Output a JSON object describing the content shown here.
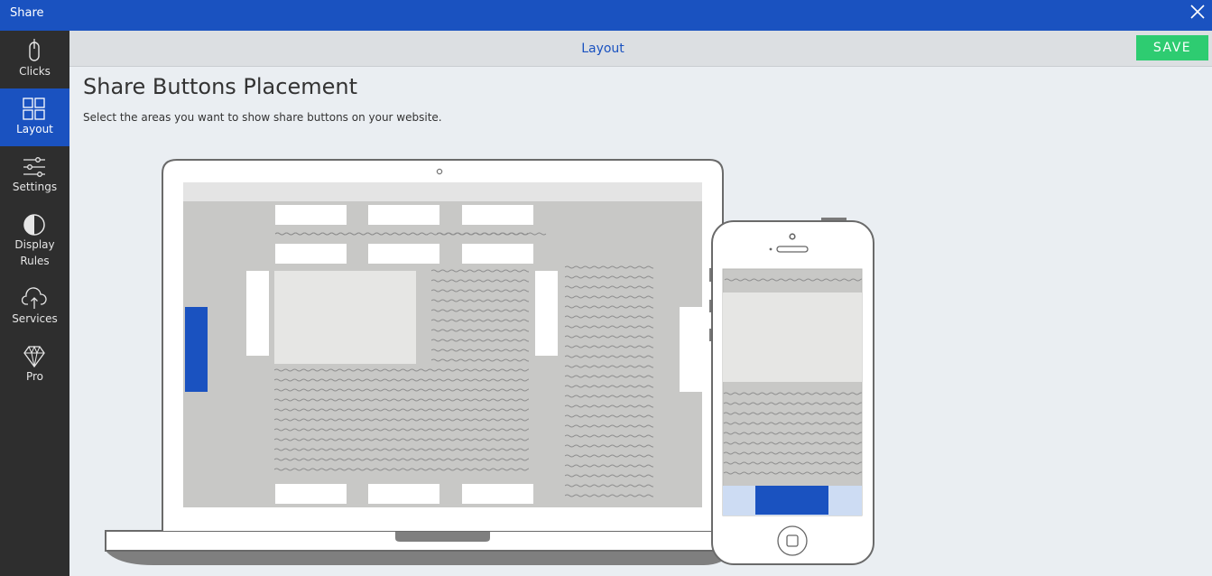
{
  "window": {
    "title": "Share",
    "close_icon": "close-icon"
  },
  "sidebar": {
    "items": [
      {
        "label": "Clicks",
        "icon": "mouse-icon",
        "active": false
      },
      {
        "label": "Layout",
        "icon": "grid-icon",
        "active": true
      },
      {
        "label": "Settings",
        "icon": "sliders-icon",
        "active": false
      },
      {
        "label": "Display Rules",
        "icon": "contrast-icon",
        "active": false
      },
      {
        "label": "Services",
        "icon": "cloud-upload-icon",
        "active": false
      },
      {
        "label": "Pro",
        "icon": "diamond-icon",
        "active": false
      }
    ]
  },
  "header": {
    "tab_label": "Layout",
    "save_label": "SAVE"
  },
  "main": {
    "title": "Share Buttons Placement",
    "description": "Select the areas you want to show share buttons on your website."
  },
  "colors": {
    "brand": "#1a52c0",
    "save": "#2ecc71",
    "selected_area": "#1a52c0",
    "mobile_bar_bg": "#cddcf3"
  },
  "placements": {
    "desktop_left_floating": true,
    "desktop_right_floating": false,
    "desktop_content_left": false,
    "desktop_content_right": false,
    "mobile_bottom_bar": true
  }
}
